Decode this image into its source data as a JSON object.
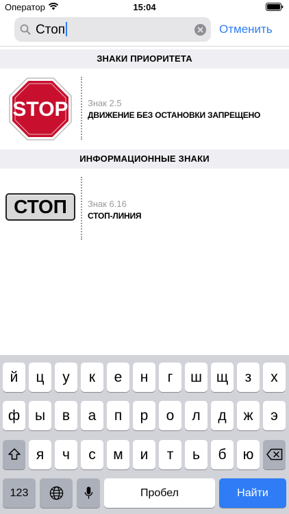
{
  "status_bar": {
    "carrier": "Оператор",
    "time": "15:04"
  },
  "search": {
    "query": "Стоп",
    "cancel_label": "Отменить"
  },
  "sections": [
    {
      "title": "ЗНАКИ ПРИОРИТЕТА",
      "items": [
        {
          "number": "Знак 2.5",
          "name": "ДВИЖЕНИЕ БЕЗ ОСТАНОВКИ ЗАПРЕЩЕНО",
          "sign_text": "STOP",
          "sign_color": "#c8102e"
        }
      ]
    },
    {
      "title": "ИНФОРМАЦИОННЫЕ ЗНАКИ",
      "items": [
        {
          "number": "Знак 6.16",
          "name": "СТОП-ЛИНИЯ",
          "sign_text": "СТОП"
        }
      ]
    }
  ],
  "keyboard": {
    "row1": [
      "й",
      "ц",
      "у",
      "к",
      "е",
      "н",
      "г",
      "ш",
      "щ",
      "з",
      "х"
    ],
    "row2": [
      "ф",
      "ы",
      "в",
      "а",
      "п",
      "р",
      "о",
      "л",
      "д",
      "ж",
      "э"
    ],
    "row3": [
      "я",
      "ч",
      "с",
      "м",
      "и",
      "т",
      "ь",
      "б",
      "ю"
    ],
    "numbers_label": "123",
    "space_label": "Пробел",
    "go_label": "Найти",
    "shift_icon": "shift-icon",
    "delete_icon": "delete-icon",
    "globe_icon": "globe-icon",
    "mic_icon": "microphone-icon"
  },
  "colors": {
    "accent": "#2f7cf6",
    "section_bg": "#efeff3",
    "keyboard_bg": "#d1d3d9"
  }
}
